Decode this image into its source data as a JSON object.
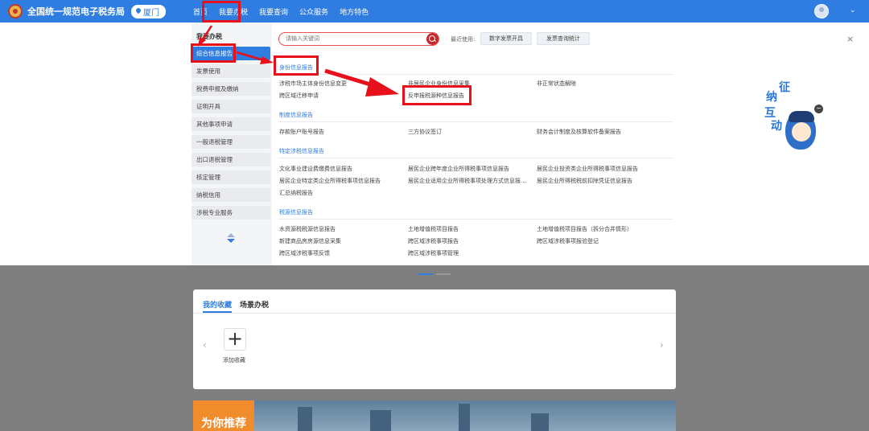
{
  "topbar": {
    "site_title": "全国统一规范电子税务局",
    "city": "厦门",
    "nav": [
      "首页",
      "我要办税",
      "我要查询",
      "公众服务",
      "地方特色"
    ],
    "chevron": "⌄"
  },
  "sidebar": {
    "heading": "我要办税",
    "items": [
      "综合信息报告",
      "发票使用",
      "税费申报及缴纳",
      "证明开具",
      "其他事项申请",
      "一般退税管理",
      "出口退税管理",
      "核定管理",
      "纳税信用",
      "涉税专业服务"
    ]
  },
  "search": {
    "placeholder": "请输入关键词"
  },
  "recent": {
    "label": "最近使用:",
    "items": [
      "数字发票开具",
      "发票查询统计"
    ]
  },
  "close": "×",
  "sections": [
    {
      "title": "身份信息报告",
      "links": [
        "涉税市场主体身份信息变更",
        "非居民企业身份信息采集",
        "非正常状态解除",
        "跨区域迁移申请",
        "反申报税源种信息报告"
      ]
    },
    {
      "title": "制度信息报告",
      "links": [
        "存款账户账号报告",
        "三方协议签订",
        "财务会计制度及核算软件备案报告"
      ]
    },
    {
      "title": "特定涉税信息报告",
      "links": [
        "文化事业建设费缴费信息报告",
        "居民企业跨年度企业所得税事项信息报告",
        "居民企业投资类企业所得税事项信息报告",
        "居民企业特定类企业所得税事项信息报告",
        "居民企业适用企业所得税事项处理方式信息报...",
        "居民企业所得税税前扣除凭证信息报告",
        "汇总纳税报告"
      ]
    },
    {
      "title": "税源信息报告",
      "links": [
        "水资源税税源信息报告",
        "土地增值税项目报告",
        "土地增值税项目报告（拆分合并情形）",
        "新建商品房房源信息采集",
        "跨区域涉税事项报告",
        "跨区域涉税事项报验登记",
        "跨区域涉税事项反馈",
        "跨区域涉税事项管理"
      ]
    }
  ],
  "mascot": {
    "chars": [
      "征",
      "纳",
      "互",
      "动"
    ],
    "close": "−"
  },
  "favorites": {
    "tabs": [
      "我的收藏",
      "场景办税"
    ],
    "add_label": "添加收藏",
    "plus": "+",
    "prev": "‹",
    "next": "›"
  },
  "banner": {
    "tag": "为你推荐"
  },
  "colors": {
    "primary": "#2f7de1",
    "highlight": "#e8101a",
    "search_btn": "#c62828"
  }
}
